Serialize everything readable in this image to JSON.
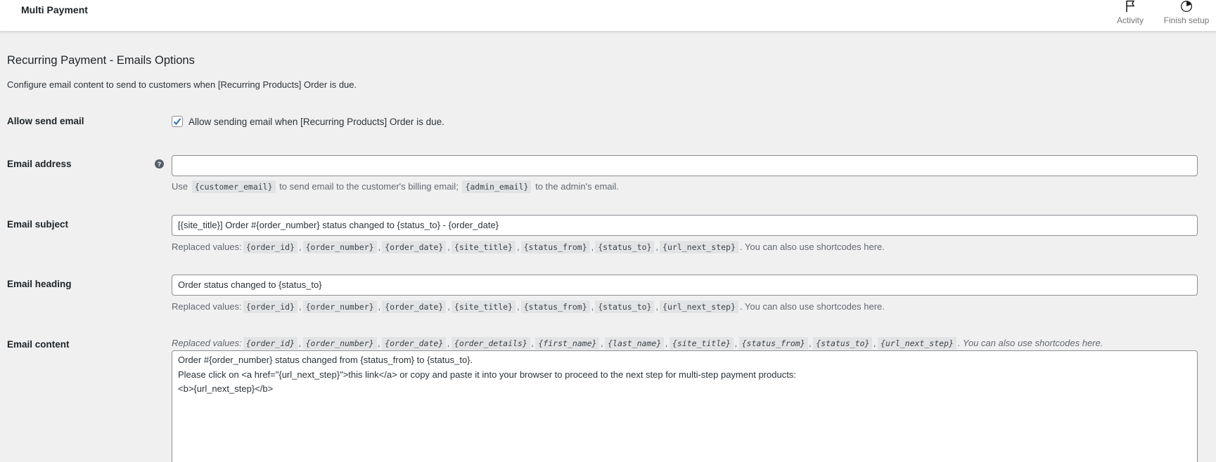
{
  "topbar": {
    "title": "Multi Payment",
    "activity_label": "Activity",
    "finish_setup_label": "Finish setup"
  },
  "page": {
    "heading": "Recurring Payment - Emails Options",
    "description": "Configure email content to send to customers when [Recurring Products] Order is due."
  },
  "allow_send_email": {
    "label": "Allow send email",
    "checked": true,
    "checkbox_label": "Allow sending email when [Recurring Products] Order is due."
  },
  "email_address": {
    "label": "Email address",
    "value": "",
    "help_icon": "question-icon",
    "desc_use": "Use",
    "code_customer": "{customer_email}",
    "desc_customer": "to send email to the customer's billing email;",
    "code_admin": "{admin_email}",
    "desc_admin": "to the admin's email."
  },
  "email_subject": {
    "label": "Email subject",
    "value": "[{site_title}] Order #{order_number} status changed to {status_to} - {order_date}"
  },
  "email_heading": {
    "label": "Email heading",
    "value": "Order status changed to {status_to}"
  },
  "replaced": {
    "prefix": "Replaced values:",
    "suffix": ". You can also use shortcodes here.",
    "basic_codes": [
      "{order_id}",
      "{order_number}",
      "{order_date}",
      "{site_title}",
      "{status_from}",
      "{status_to}",
      "{url_next_step}"
    ],
    "content_codes": [
      "{order_id}",
      "{order_number}",
      "{order_date}",
      "{order_details}",
      "{first_name}",
      "{last_name}",
      "{site_title}",
      "{status_from}",
      "{status_to}",
      "{url_next_step}"
    ]
  },
  "email_content": {
    "label": "Email content",
    "lines": [
      "Order #{order_number} status changed from {status_from} to {status_to}.",
      "Please click on <a href=\"{url_next_step}\">this link</a> or copy and paste it into your browser to proceed to the next step for multi-step payment products:",
      "<b>{url_next_step}</b>"
    ]
  },
  "colors": {
    "background": "#f0f0f1",
    "checkbox_tick": "#2271b1"
  }
}
